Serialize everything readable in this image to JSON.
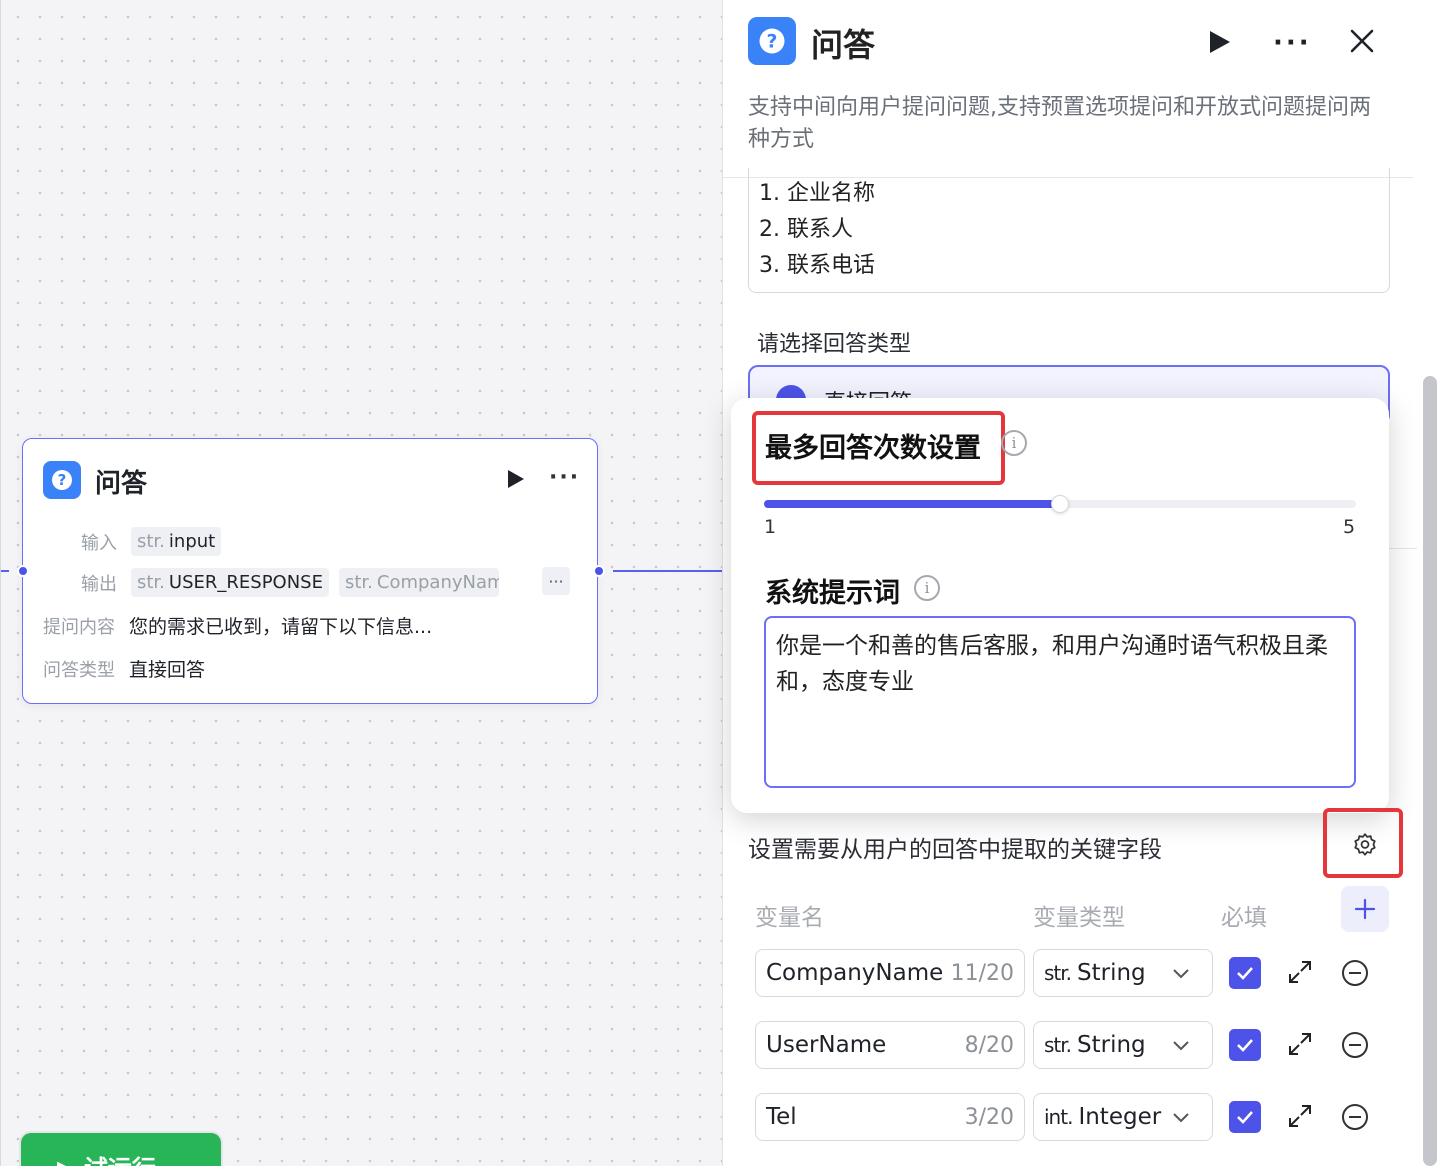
{
  "node": {
    "title": "问答",
    "input_label": "输入",
    "input_type": "str.",
    "input_value": "input",
    "output_label": "输出",
    "outputs": [
      {
        "type": "str.",
        "name": "USER_RESPONSE"
      },
      {
        "type": "str.",
        "name": "CompanyNam"
      }
    ],
    "question_label": "提问内容",
    "question_value": "您的需求已收到，请留下以下信息...",
    "answer_type_label": "问答类型",
    "answer_type_value": "直接回答",
    "run_icon": "play-icon",
    "more_icon": "more-icon"
  },
  "run_button": {
    "label": "▶ 试运行"
  },
  "panel": {
    "title": "问答",
    "description": "支持中间向用户提问问题,支持预置选项提问和开放式问题提问两种方式",
    "list_items": [
      "1. 企业名称",
      "2. 联系人",
      "3. 联系电话"
    ],
    "answer_type_label": "请选择回答类型",
    "answer_option": "直接回答"
  },
  "popup": {
    "max_answer_title": "最多回答次数设置",
    "slider": {
      "min": "1",
      "max": "5",
      "value_fraction": 0.5
    },
    "system_prompt_title": "系统提示词",
    "system_prompt_text": "你是一个和善的售后客服，和用户沟通时语气积极且柔和，态度专业"
  },
  "extract": {
    "label": "设置需要从用户的回答中提取的关键字段",
    "columns": {
      "name": "变量名",
      "type": "变量类型",
      "required": "必填"
    },
    "rows": [
      {
        "name": "CompanyName",
        "count": "11/20",
        "type_prefix": "str.",
        "type": "String",
        "required": true
      },
      {
        "name": "UserName",
        "count": "8/20",
        "type_prefix": "str.",
        "type": "String",
        "required": true
      },
      {
        "name": "Tel",
        "count": "3/20",
        "type_prefix": "int.",
        "type": "Integer",
        "required": true
      }
    ]
  },
  "colors": {
    "accent": "#4d53e8",
    "highlight": "#e5363c",
    "run_green": "#28b558",
    "icon_blue": "#3a82f7"
  }
}
